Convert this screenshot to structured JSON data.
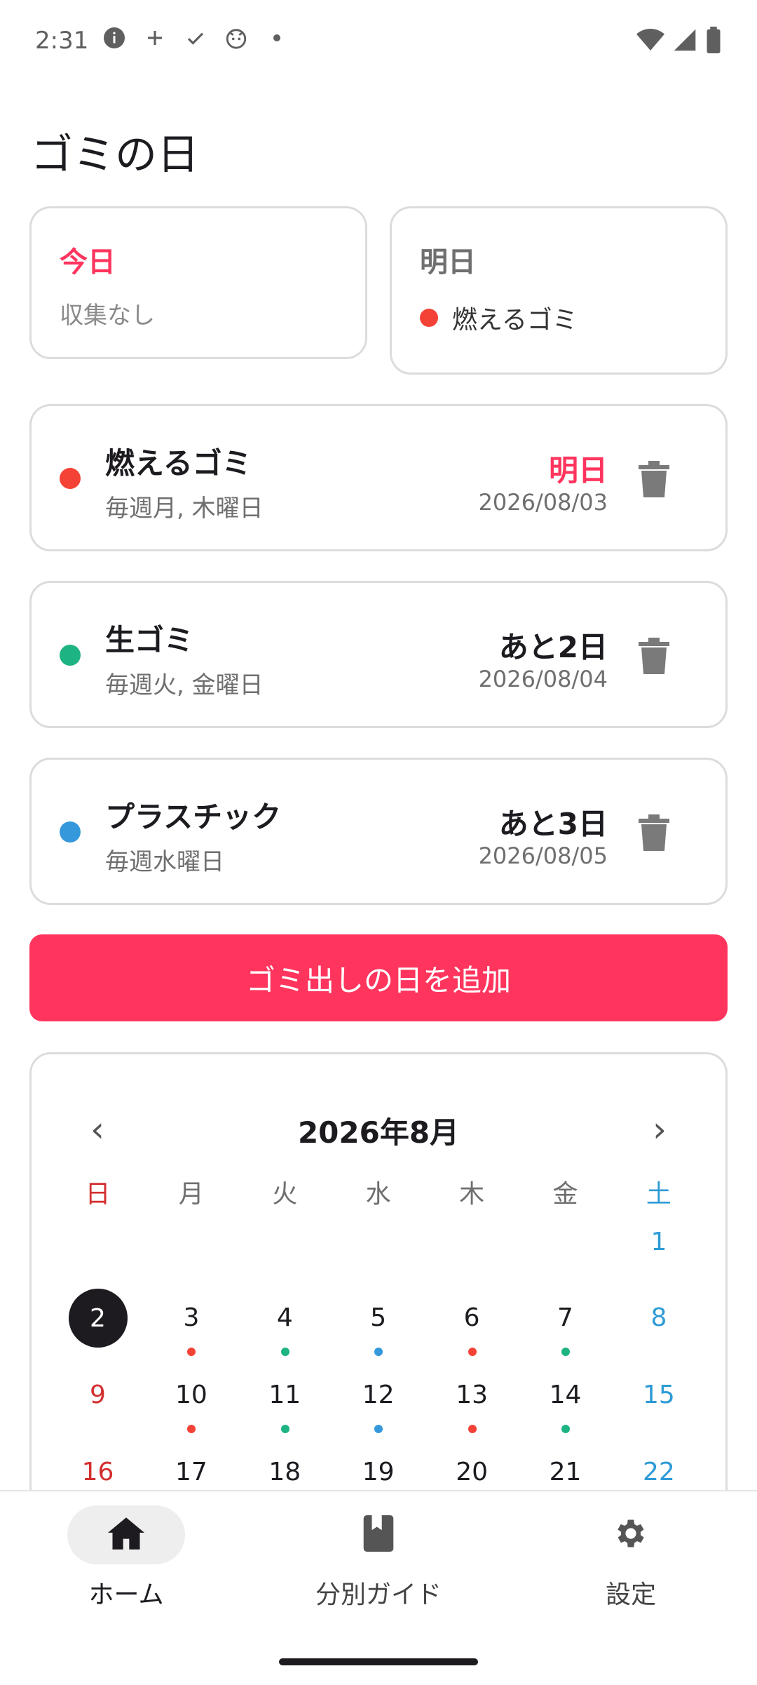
{
  "status": {
    "time": "2:31"
  },
  "page": {
    "title": "ゴミの日"
  },
  "today": {
    "title": "今日",
    "text": "収集なし"
  },
  "tomorrow": {
    "title": "明日",
    "item": "燃えるゴミ",
    "color": "#f44336"
  },
  "schedules": [
    {
      "name": "燃えるゴミ",
      "rule": "毎週月, 木曜日",
      "relative": "明日",
      "date": "2026/08/03",
      "color": "#f44336",
      "rel_color": "#ff355e"
    },
    {
      "name": "生ゴミ",
      "rule": "毎週火, 金曜日",
      "relative": "あと2日",
      "date": "2026/08/04",
      "color": "#1db383",
      "rel_color": "#1d1b20"
    },
    {
      "name": "プラスチック",
      "rule": "毎週水曜日",
      "relative": "あと3日",
      "date": "2026/08/05",
      "color": "#3498db",
      "rel_color": "#1d1b20"
    }
  ],
  "add_button": {
    "label": "ゴミ出しの日を追加"
  },
  "calendar": {
    "month": "2026年8月",
    "prev": "‹",
    "next": "›",
    "weekdays": [
      "日",
      "月",
      "火",
      "水",
      "木",
      "金",
      "土"
    ],
    "rows": [
      [
        "",
        "",
        "",
        "",
        "",
        "",
        "1"
      ],
      [
        "2",
        "3",
        "4",
        "5",
        "6",
        "7",
        "8"
      ],
      [
        "9",
        "10",
        "11",
        "12",
        "13",
        "14",
        "15"
      ],
      [
        "16",
        "17",
        "18",
        "19",
        "20",
        "21",
        "22"
      ]
    ],
    "dots": [
      [
        "",
        "",
        "",
        "",
        "",
        "",
        ""
      ],
      [
        "",
        "#f44336",
        "#1db383",
        "#3498db",
        "#f44336",
        "#1db383",
        ""
      ],
      [
        "",
        "#f44336",
        "#1db383",
        "#3498db",
        "#f44336",
        "#1db383",
        ""
      ],
      [
        "",
        "",
        "",
        "",
        "",
        "",
        ""
      ]
    ],
    "today": "2",
    "sunday_color": "#d32f2f",
    "saturday_color": "#2e9bd6"
  },
  "nav": [
    {
      "label": "ホーム",
      "icon": "home-icon",
      "active": true
    },
    {
      "label": "分別ガイド",
      "icon": "book-icon",
      "active": false
    },
    {
      "label": "設定",
      "icon": "gear-icon",
      "active": false
    }
  ]
}
